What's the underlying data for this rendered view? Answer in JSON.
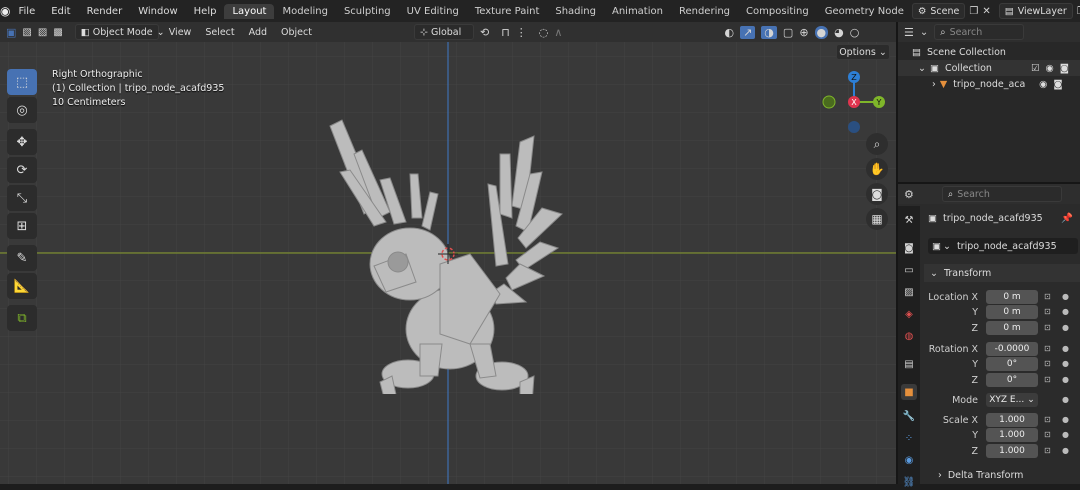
{
  "menus": [
    "File",
    "Edit",
    "Render",
    "Window",
    "Help"
  ],
  "workspaces": [
    {
      "label": "Layout",
      "active": true
    },
    {
      "label": "Modeling"
    },
    {
      "label": "Sculpting"
    },
    {
      "label": "UV Editing"
    },
    {
      "label": "Texture Paint"
    },
    {
      "label": "Shading"
    },
    {
      "label": "Animation"
    },
    {
      "label": "Rendering"
    },
    {
      "label": "Compositing"
    },
    {
      "label": "Geometry Node"
    }
  ],
  "scene": {
    "name": "Scene"
  },
  "view_layer": {
    "name": "ViewLayer"
  },
  "viewport_header": {
    "mode": "Object Mode",
    "menus": [
      "View",
      "Select",
      "Add",
      "Object"
    ],
    "orientation": "Global",
    "options": "Options"
  },
  "viewport_overlay": {
    "view_name": "Right Orthographic",
    "collection_line": "(1) Collection | tripo_node_acafd935",
    "scale": "10 Centimeters"
  },
  "gizmo": {
    "x": "X",
    "y": "Y",
    "z": "Z"
  },
  "outliner": {
    "search_placeholder": "Search",
    "scene_collection": "Scene Collection",
    "collection": "Collection",
    "object": "tripo_node_aca"
  },
  "properties": {
    "search_placeholder": "Search",
    "object_name": "tripo_node_acafd935",
    "datablock_name": "tripo_node_acafd935",
    "transform_title": "Transform",
    "location_label": "Location X",
    "location": {
      "x": "0 m",
      "y": "0 m",
      "z": "0 m"
    },
    "rotation_label": "Rotation X",
    "rotation": {
      "x": "-0.0000",
      "y": "0°",
      "z": "0°"
    },
    "mode_label": "Mode",
    "mode_value": "XYZ E...",
    "scale_label": "Scale X",
    "scale": {
      "x": "1.000",
      "y": "1.000",
      "z": "1.000"
    },
    "y_label": "Y",
    "z_label": "Z",
    "delta_title": "Delta Transform"
  },
  "colors": {
    "accent": "#4772b3",
    "x_axis": "#e0344e",
    "y_axis": "#7fb62a",
    "z_axis": "#2d7fd6",
    "viewport_bg": "#393939",
    "object": "#bfbfbf"
  }
}
